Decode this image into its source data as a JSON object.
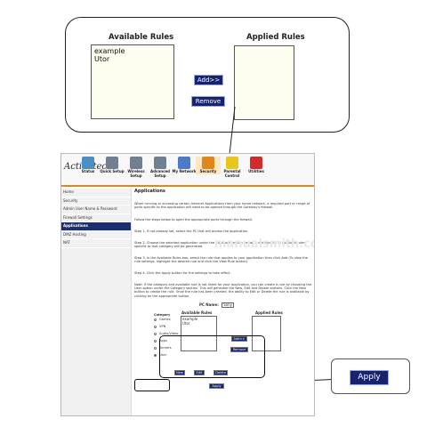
{
  "zoom_callout": {
    "available_rules_title": "Available Rules",
    "applied_rules_title": "Applied Rules",
    "available_rules_items": [
      "example",
      "Utor"
    ],
    "add_button": "Add>>",
    "remove_button": "Remove"
  },
  "app": {
    "logo": "Actiontec®",
    "tabs": [
      {
        "label": "Status",
        "icon": "status-icon",
        "color": "#4a90c8"
      },
      {
        "label": "Quick Setup",
        "icon": "quick-setup-icon",
        "color": "#708090"
      },
      {
        "label": "Wireless Setup",
        "icon": "wireless-setup-icon",
        "color": "#708090"
      },
      {
        "label": "Advanced Setup",
        "icon": "advanced-setup-icon",
        "color": "#708090"
      },
      {
        "label": "My Network",
        "icon": "my-network-icon",
        "color": "#4a7ac9"
      },
      {
        "label": "Security",
        "icon": "security-icon",
        "color": "#e0861a"
      },
      {
        "label": "Parental Control",
        "icon": "parental-control-icon",
        "color": "#e7c81a"
      },
      {
        "label": "Utilities",
        "icon": "utilities-icon",
        "color": "#d22b2b"
      }
    ],
    "sidebar": [
      {
        "label": "Home",
        "active": false
      },
      {
        "label": "Security",
        "active": false
      },
      {
        "label": "Admin User Name & Password",
        "active": false
      },
      {
        "label": "Firewall Settings",
        "active": false
      },
      {
        "label": "Applications",
        "active": true
      },
      {
        "label": "DMZ Hosting",
        "active": false
      },
      {
        "label": "NAT",
        "active": false
      }
    ],
    "content": {
      "title": "Applications",
      "p1": "When running or accessing certain Internet Applications from your home network, a required port or range of ports specific to the application will need to be opened through the Gateway's firewall.",
      "p2": "Follow the steps below to open the appropriate ports through the firewall.",
      "step1": "Step 1. If not already set, select the PC that will access the application.",
      "step2": "Step 2. Choose the selected application under the Category section below. A detailed list of available rules specific to that category will be generated.",
      "step3": "Step 3. In the Available Rules box, select the rule that applies to your application then click Add (To view the rule settings, highlight the desired rule and click the View Rule button).",
      "step4": "Step 4. Click the Apply button for the settings to take effect.",
      "note": "Note: If the category and available rule is not listed for your application, you can create a rule by choosing the User option under the Category section. This will generate the New, Edit and Delete buttons. Click the New button to create the rule. Once the rule has been created, the ability to Edit or Delete the rule is available by clicking on the appropriate button.",
      "pc_name_label": "PC Name:",
      "pc_name_value": "Sony",
      "category_title": "Category",
      "categories": [
        "Games",
        "VPN",
        "Audio/Video",
        "Apps",
        "Servers",
        "User"
      ],
      "available_rules_title": "Available Rules",
      "applied_rules_title": "Applied Rules",
      "available_rules_items": [
        "example",
        "Utor"
      ],
      "add_button": "Add>>",
      "remove_button": "Remove",
      "new_button": "New",
      "edit_button": "Edit",
      "delete_button": "Delete",
      "apply_button": "Apply"
    }
  },
  "apply_callout": {
    "apply_button": "Apply"
  },
  "watermark": "manualsmith.com"
}
